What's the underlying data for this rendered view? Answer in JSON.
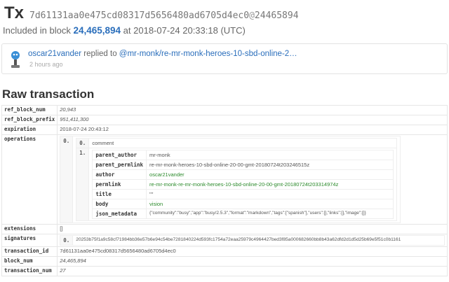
{
  "header": {
    "tx_label": "Tx",
    "tx_hash": "7d61131aa0e475cd08317d5656480ad6705d4ec0",
    "at_sign": "@",
    "block_num_short": "24465894"
  },
  "included": {
    "prefix": "Included in block",
    "block": "24,465,894",
    "suffix": "at 2018-07-24 20:33:18 (UTC)"
  },
  "activity": {
    "author": "oscar21vander",
    "verb": "replied to",
    "target": "@mr-monk/re-mr-monk-heroes-10-sbd-online-2…",
    "time": "2 hours ago"
  },
  "raw": {
    "heading": "Raw transaction",
    "ref_block_num_key": "ref_block_num",
    "ref_block_num": "20,943",
    "ref_block_prefix_key": "ref_block_prefix",
    "ref_block_prefix": "951,411,300",
    "expiration_key": "expiration",
    "expiration": "2018-07-24 20:43:12",
    "operations_key": "operations",
    "op_index": "0.",
    "op_inner_index0": "0.",
    "op_type": "comment",
    "op_inner_index1": "1.",
    "fields": [
      {
        "key": "parent_author",
        "value": "mr-monk"
      },
      {
        "key": "parent_permlink",
        "value": "re-mr-monk-heroes-10-sbd-online-20-00-gmt-20180724t203246515z"
      },
      {
        "key": "author",
        "value": "oscar21vander"
      },
      {
        "key": "permlink",
        "value": "re-mr-monk-re-mr-monk-heroes-10-sbd-online-20-00-gmt-20180724t203314974z"
      },
      {
        "key": "title",
        "value": "\"\""
      },
      {
        "key": "body",
        "value": "vision"
      },
      {
        "key": "json_metadata",
        "value": "{\"community\":\"busy\",\"app\":\"busy/2.5.3\",\"format\":\"markdown\",\"tags\":[\"spanish\"],\"users\":[],\"links\":[],\"image\":[]}"
      }
    ],
    "extensions_key": "extensions",
    "extensions": "[]",
    "signatures_key": "signatures",
    "sig_index": "0.",
    "signature": "20253b75f1a9c58cf71984bb36e57b6e94c54be7281840224d593fc1754a72eaa25979c4964427bed3f85a000682660bb8b43a62dfd2d1d5d25b69e5f51c0b1161",
    "transaction_id_key": "transaction_id",
    "transaction_id": "7d61131aa0e475cd08317d5656480ad6705d4ec0",
    "block_num_key": "block_num",
    "block_num": "24,465,894",
    "transaction_num_key": "transaction_num",
    "transaction_num": "27"
  }
}
